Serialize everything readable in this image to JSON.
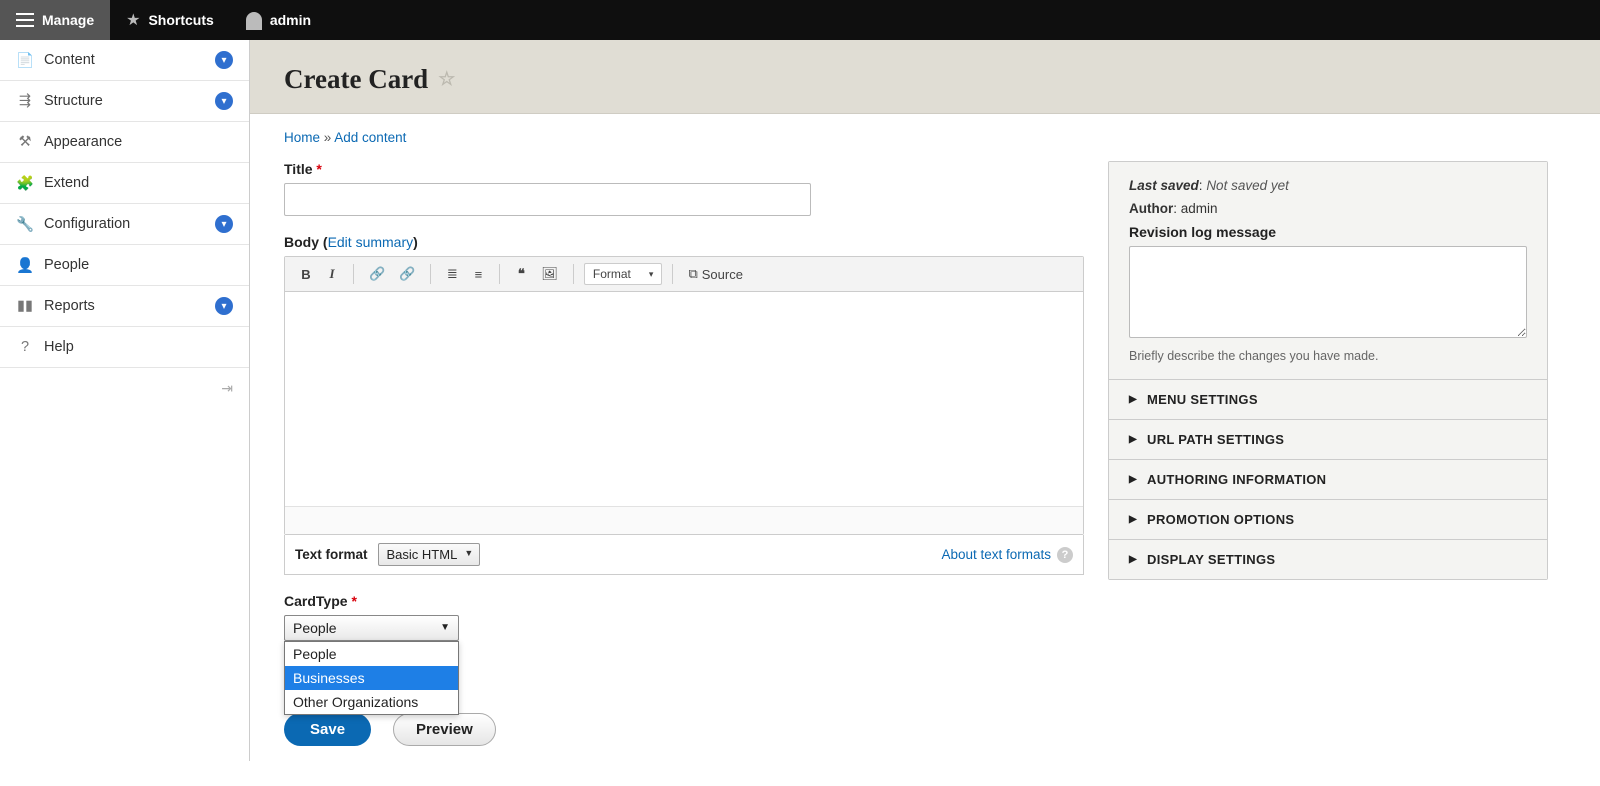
{
  "topbar": {
    "manage": "Manage",
    "shortcuts": "Shortcuts",
    "user": "admin"
  },
  "sidebar": {
    "items": [
      {
        "label": "Content",
        "icon": "file-icon",
        "expandable": true
      },
      {
        "label": "Structure",
        "icon": "hierarchy-icon",
        "expandable": true
      },
      {
        "label": "Appearance",
        "icon": "gavel-icon",
        "expandable": false
      },
      {
        "label": "Extend",
        "icon": "puzzle-icon",
        "expandable": false
      },
      {
        "label": "Configuration",
        "icon": "wrench-icon",
        "expandable": true
      },
      {
        "label": "People",
        "icon": "person-icon",
        "expandable": false
      },
      {
        "label": "Reports",
        "icon": "bars-icon",
        "expandable": true
      },
      {
        "label": "Help",
        "icon": "question-icon",
        "expandable": false
      }
    ]
  },
  "page": {
    "title": "Create Card"
  },
  "breadcrumbs": {
    "home": "Home",
    "sep": " » ",
    "add_content": "Add content"
  },
  "form": {
    "title_label": "Title",
    "title_value": "",
    "body_label": "Body",
    "edit_summary": "Edit summary",
    "format_placeholder": "Format",
    "source_label": "Source",
    "text_format_label": "Text format",
    "text_format_value": "Basic HTML",
    "about_text_formats": "About text formats",
    "cardtype_label": "CardType",
    "cardtype_selected": "People",
    "cardtype_options": [
      "People",
      "Businesses",
      "Other Organizations"
    ],
    "cardtype_highlight_index": 1,
    "save": "Save",
    "preview": "Preview"
  },
  "meta": {
    "last_saved_k": "Last saved",
    "last_saved_v": "Not saved yet",
    "author_k": "Author",
    "author_v": "admin",
    "revision_label": "Revision log message",
    "revision_value": "",
    "revision_hint": "Briefly describe the changes you have made.",
    "accordions": [
      "MENU SETTINGS",
      "URL PATH SETTINGS",
      "AUTHORING INFORMATION",
      "PROMOTION OPTIONS",
      "DISPLAY SETTINGS"
    ]
  }
}
